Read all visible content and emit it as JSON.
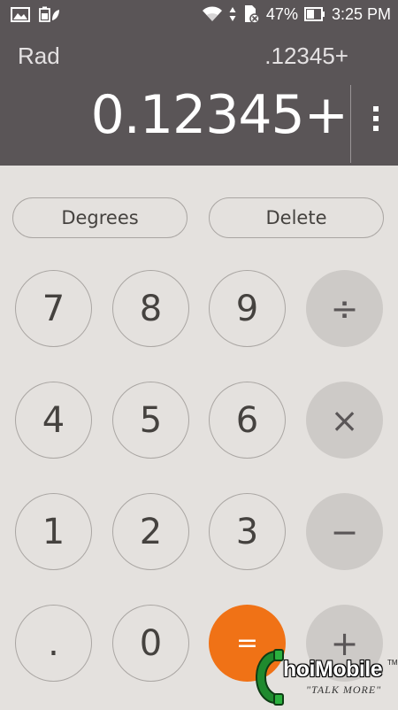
{
  "status_bar": {
    "battery_percent": "47%",
    "time": "3:25 PM",
    "icons_left": [
      "gallery-icon",
      "battery-saver-icon"
    ],
    "icons_right": [
      "wifi-icon",
      "data-arrows-icon",
      "sim-no-service-icon",
      "battery-icon"
    ]
  },
  "display": {
    "mode": "Rad",
    "expression": ".12345+",
    "result": "0.12345+"
  },
  "keypad": {
    "degrees_label": "Degrees",
    "delete_label": "Delete",
    "keys": {
      "seven": "7",
      "eight": "8",
      "nine": "9",
      "divide": "÷",
      "four": "4",
      "five": "5",
      "six": "6",
      "multiply": "×",
      "one": "1",
      "two": "2",
      "three": "3",
      "minus": "−",
      "dot": ".",
      "zero": "0",
      "equals": "=",
      "plus": "+"
    }
  },
  "watermark": {
    "brand": "hoiMobile",
    "tagline": "\"TALK MORE\"",
    "trademark": "TM"
  },
  "colors": {
    "display_bg": "#5a5557",
    "keypad_bg": "#e4e1de",
    "operator_bg": "#cdcac7",
    "equals_bg": "#f07216"
  }
}
